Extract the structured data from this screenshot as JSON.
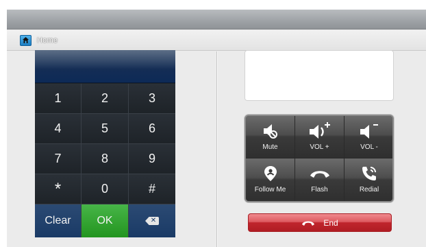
{
  "nav": {
    "home_label": "Home"
  },
  "keypad": {
    "keys": [
      "1",
      "2",
      "3",
      "4",
      "5",
      "6",
      "7",
      "8",
      "9",
      "*",
      "0",
      "#"
    ],
    "clear_label": "Clear",
    "ok_label": "OK"
  },
  "controls": {
    "mute": "Mute",
    "vol_up": "VOL +",
    "vol_down": "VOL -",
    "follow_me": "Follow Me",
    "flash": "Flash",
    "redial": "Redial"
  },
  "end_label": "End",
  "colors": {
    "ok": "#2aa02a",
    "end": "#cc2d33",
    "clear": "#1a3a66",
    "display": "#0d2a57"
  }
}
